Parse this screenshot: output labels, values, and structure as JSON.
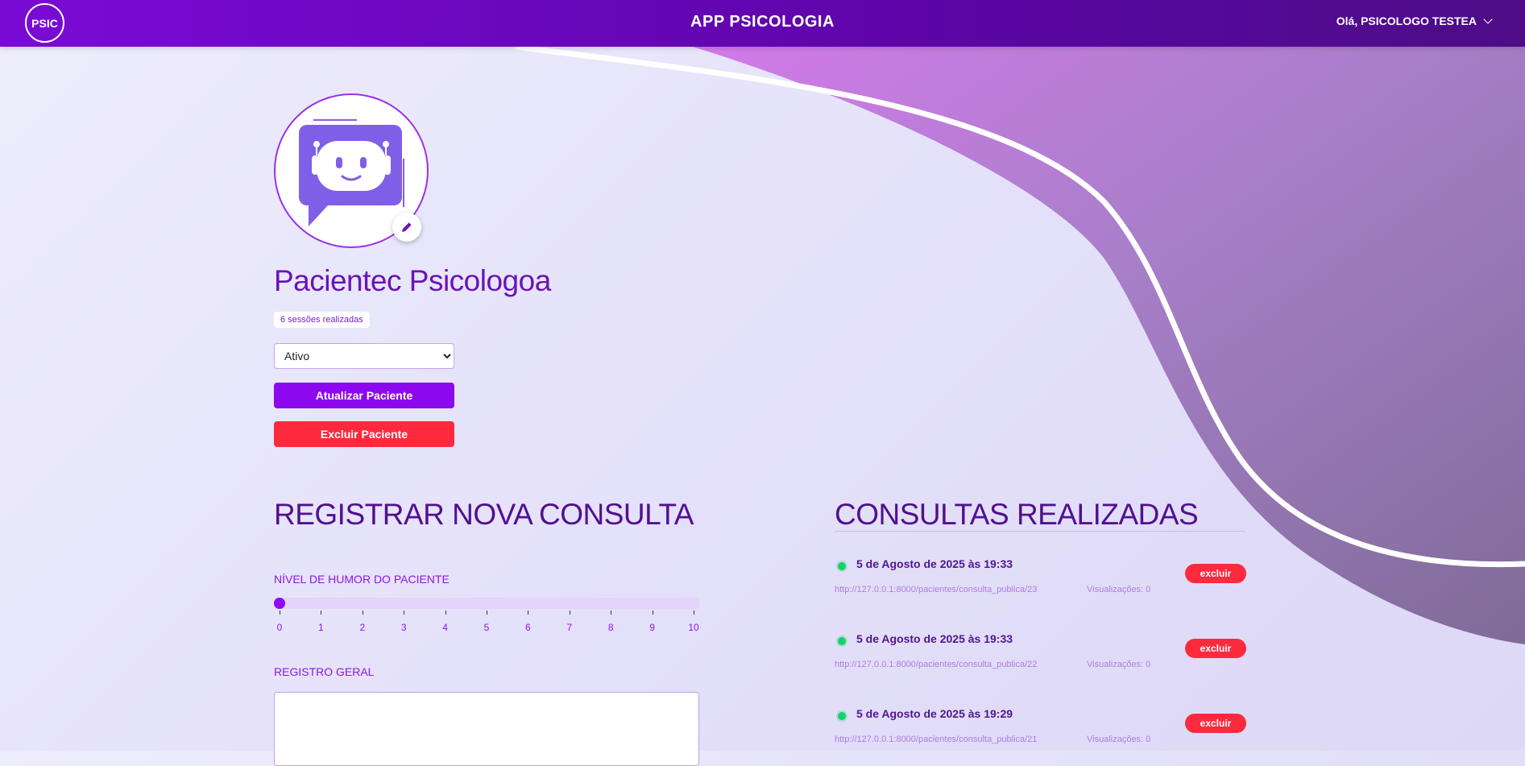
{
  "header": {
    "logo_text": "PSIC",
    "app_title": "APP PSICOLOGIA",
    "user_greeting": "Olá, PSICOLOGO TESTEA"
  },
  "patient": {
    "name": "Pacientec Psicologoa",
    "sessions": "6 sessões realizadas",
    "status_selected": "Ativo",
    "update_label": "Atualizar Paciente",
    "delete_label": "Excluir Paciente"
  },
  "new_consultation": {
    "title": "REGISTRAR NOVA CONSULTA",
    "mood_label": "NÍVEL DE HUMOR DO PACIENTE",
    "mood_value": 0,
    "scale": [
      "0",
      "1",
      "2",
      "3",
      "4",
      "5",
      "6",
      "7",
      "8",
      "9",
      "10"
    ],
    "general_label": "REGISTRO GERAL"
  },
  "consultations": {
    "title": "CONSULTAS REALIZADAS",
    "items": [
      {
        "date": "5 de Agosto de 2025 às 19:33",
        "url": "http://127.0.0.1:8000/pacientes/consulta_publica/23",
        "views": "Visualizações: 0",
        "delete": "excluir"
      },
      {
        "date": "5 de Agosto de 2025 às 19:33",
        "url": "http://127.0.0.1:8000/pacientes/consulta_publica/22",
        "views": "Visualizações: 0",
        "delete": "excluir"
      },
      {
        "date": "5 de Agosto de 2025 às 19:29",
        "url": "http://127.0.0.1:8000/pacientes/consulta_publica/21",
        "views": "Visualizações: 0",
        "delete": "excluir"
      }
    ]
  },
  "colors": {
    "primary": "#8e08ef",
    "danger": "#fd2a3e",
    "heading": "#52108f",
    "status_dot": "#14d36a"
  },
  "icons": {
    "avatar": "robot-chat-icon",
    "edit": "pencil-icon",
    "user_menu": "chevron-down-icon"
  }
}
